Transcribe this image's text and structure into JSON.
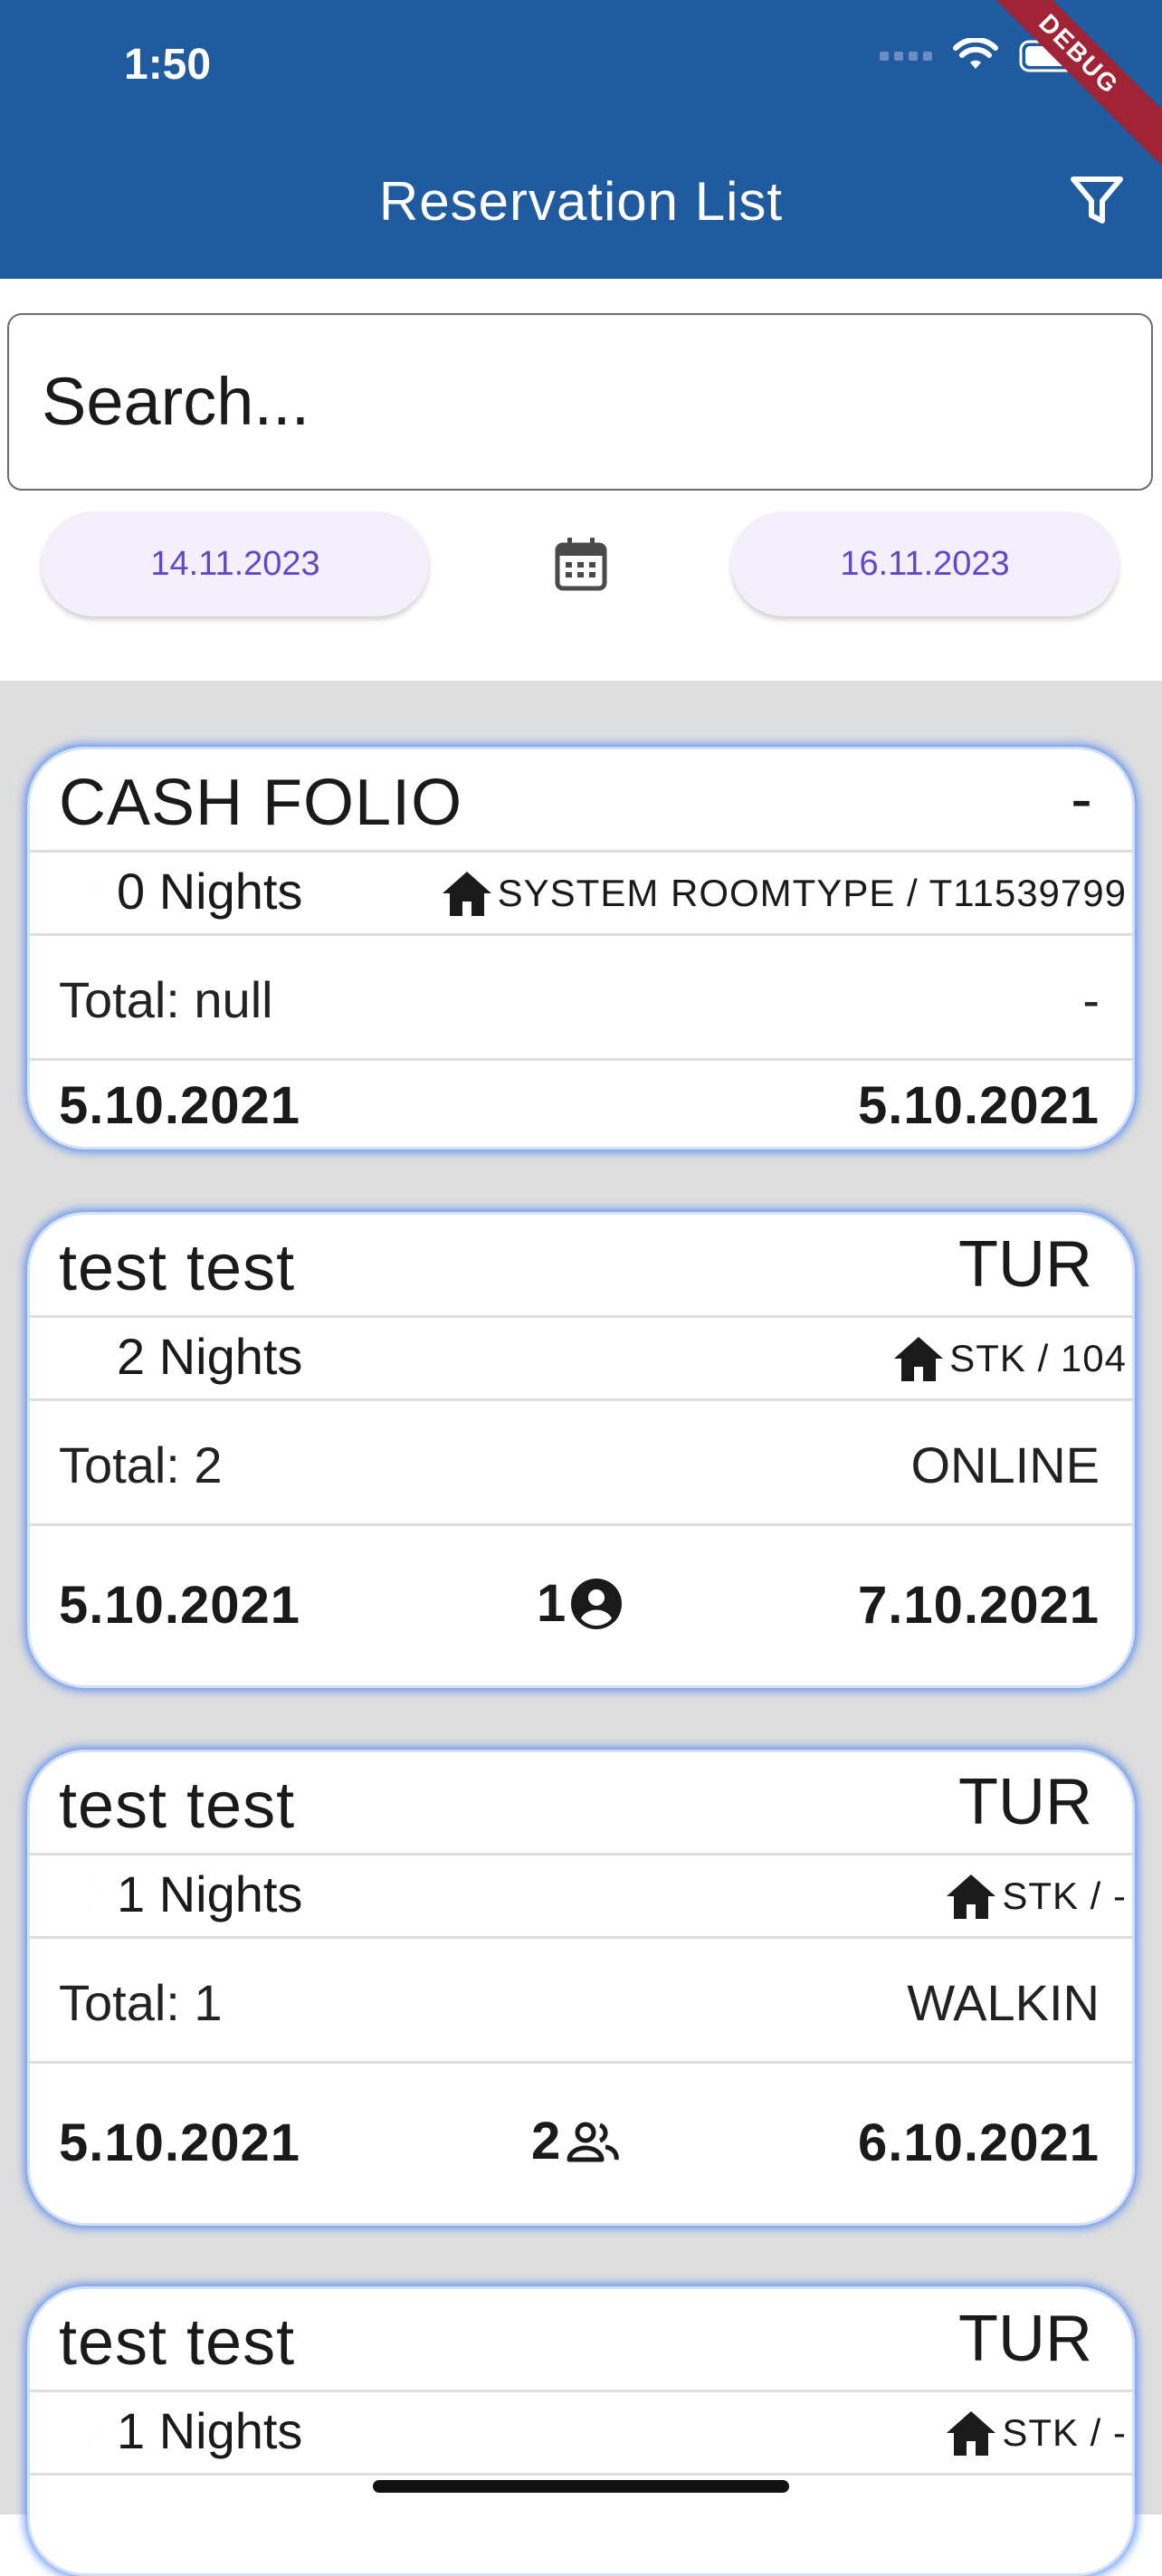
{
  "status_bar": {
    "time": "1:50"
  },
  "app_bar": {
    "title": "Reservation List",
    "debug_banner": "DEBUG",
    "filter_icon": "filter-icon"
  },
  "search": {
    "placeholder": "Search..."
  },
  "date_range": {
    "start": "14.11.2023",
    "end": "16.11.2023",
    "icon": "calendar-icon"
  },
  "reservations": [
    {
      "name": "CASH FOLIO",
      "code": "-",
      "nights": "0 Nights",
      "room": "SYSTEM ROOMTYPE / T11539799",
      "total": "Total: null",
      "channel": "-",
      "arrival": "5.10.2021",
      "departure": "5.10.2021",
      "guests": ""
    },
    {
      "name": "test test",
      "code": "TUR",
      "nights": "2 Nights",
      "room": "STK / 104",
      "total": "Total: 2",
      "channel": "ONLINE",
      "arrival": "5.10.2021",
      "departure": "7.10.2021",
      "guests": "1"
    },
    {
      "name": "test test",
      "code": "TUR",
      "nights": "1 Nights",
      "room": "STK / -",
      "total": "Total: 1",
      "channel": "WALKIN",
      "arrival": "5.10.2021",
      "departure": "6.10.2021",
      "guests": "2"
    },
    {
      "name": "test test",
      "code": "TUR",
      "nights": "1 Nights",
      "room": "STK / -"
    }
  ]
}
